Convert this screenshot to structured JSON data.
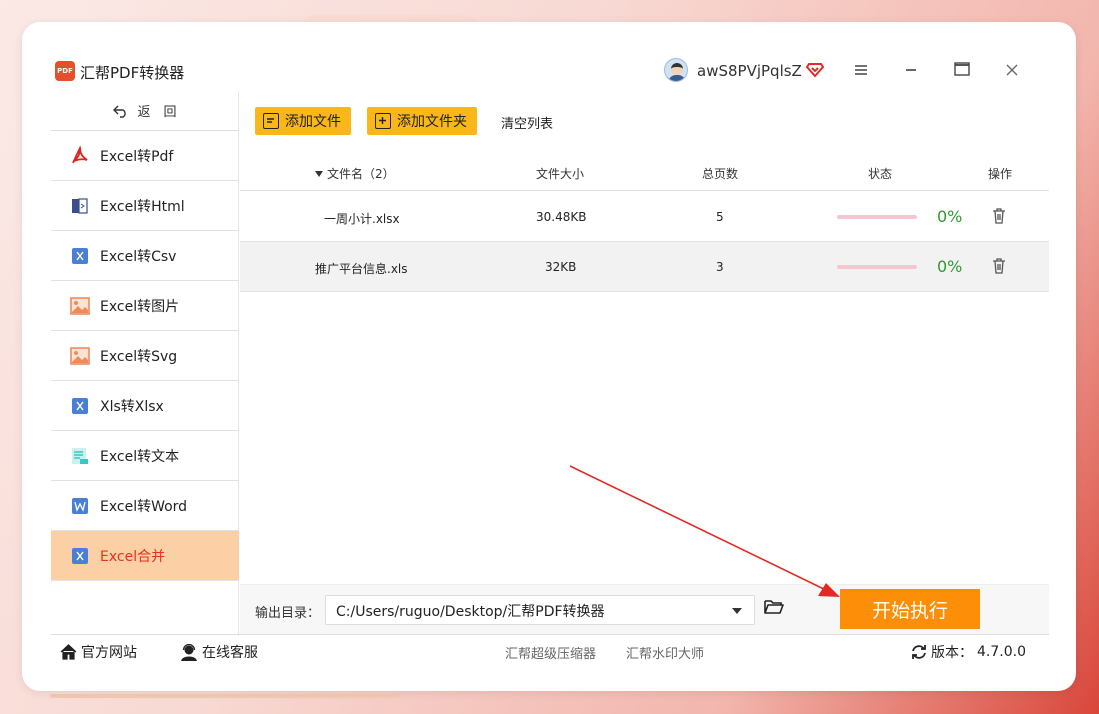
{
  "app": {
    "logo_text": "PDF",
    "title": "汇帮PDF转换器",
    "username": "awS8PVjPqlsZ"
  },
  "sidebar": {
    "back_label": "返　回",
    "items": [
      {
        "label": "Excel转Pdf",
        "icon": "pdf-icon",
        "color": "#e0241b"
      },
      {
        "label": "Excel转Html",
        "icon": "html-icon",
        "color": "#3a4e8c"
      },
      {
        "label": "Excel转Csv",
        "icon": "excel-x-icon",
        "color": "#4a7fd6"
      },
      {
        "label": "Excel转图片",
        "icon": "image-icon",
        "color": "#f08a5d"
      },
      {
        "label": "Excel转Svg",
        "icon": "image-icon",
        "color": "#f08a5d"
      },
      {
        "label": "Xls转Xlsx",
        "icon": "excel-x-icon",
        "color": "#4a7fd6"
      },
      {
        "label": "Excel转文本",
        "icon": "text-doc-icon",
        "color": "#33c9c4"
      },
      {
        "label": "Excel转Word",
        "icon": "word-icon",
        "color": "#4a7fd6"
      },
      {
        "label": "Excel合并",
        "icon": "excel-x-icon",
        "color": "#4a7fd6",
        "active": true
      }
    ]
  },
  "toolbar": {
    "add_file": "添加文件",
    "add_folder": "添加文件夹",
    "clear_list": "清空列表"
  },
  "table": {
    "headers": {
      "name": "文件名（2）",
      "size": "文件大小",
      "pages": "总页数",
      "status": "状态",
      "action": "操作"
    },
    "rows": [
      {
        "name": "一周小计.xlsx",
        "size": "30.48KB",
        "pages": "5",
        "progress": "0%"
      },
      {
        "name": "推广平台信息.xls",
        "size": "32KB",
        "pages": "3",
        "progress": "0%"
      }
    ]
  },
  "output": {
    "label": "输出目录：",
    "path": "C:/Users/ruguo/Desktop/汇帮PDF转换器"
  },
  "start_button": "开始执行",
  "statusbar": {
    "website": "官方网站",
    "support": "在线客服",
    "link1": "汇帮超级压缩器",
    "link2": "汇帮水印大师",
    "version_label": "版本：",
    "version": "4.7.0.0"
  },
  "colors": {
    "accent": "#fbb618",
    "start": "#fd8e07",
    "active_bg": "#fdcfa5",
    "active_text": "#e8321c",
    "progress": "#2f9a2f"
  }
}
